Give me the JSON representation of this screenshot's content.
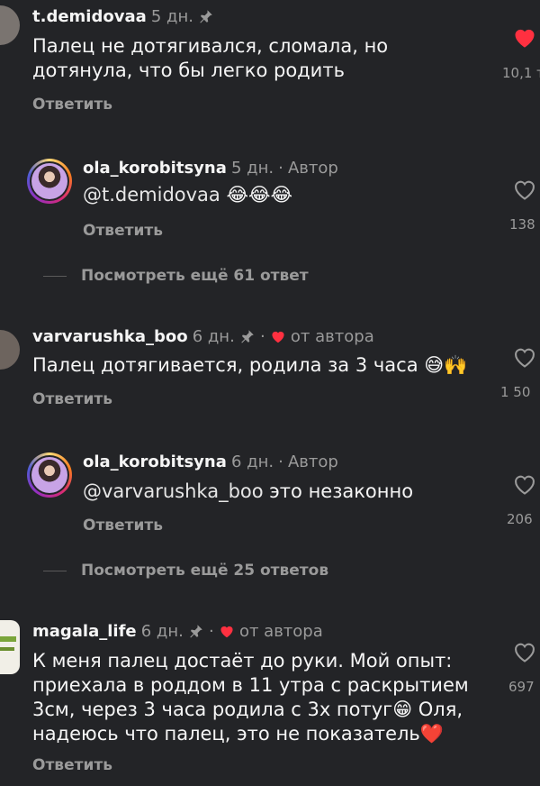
{
  "comments": [
    {
      "username": "t.demidovaa",
      "time": "5 дн.",
      "text": "Палец не дотягивался, сломала, но дотянула, что бы легко родить",
      "reply_label": "Ответить",
      "likes": "10,1 т.",
      "liked": true
    },
    {
      "username": "ola_korobitsyna",
      "time": "5 дн.",
      "author_label": "Автор",
      "mention": "@t.demidovaa",
      "text_suffix": "😂😂😂",
      "reply_label": "Ответить",
      "likes": "138"
    },
    {
      "username": "varvarushka_boo",
      "time": "6 дн.",
      "from_author_label": "от автора",
      "text": "Палец дотягивается, родила за 3 часа 😅🙌",
      "reply_label": "Ответить",
      "likes": "1 50"
    },
    {
      "username": "ola_korobitsyna",
      "time": "6 дн.",
      "author_label": "Автор",
      "mention": "@varvarushka_boo",
      "text_suffix": " это незаконно",
      "reply_label": "Ответить",
      "likes": "206"
    },
    {
      "username": "magala_life",
      "time": "6 дн.",
      "from_author_label": "от автора",
      "text": "К меня палец достаёт до руки. Мой опыт: приехала в роддом в 11 утра с раскрытием 3см, через 3 часа родила с 3х потуг😁 Оля, надеюсь что палец, это не показатель❤️",
      "reply_label": "Ответить",
      "likes": "697"
    }
  ],
  "more_replies": [
    {
      "label": "Посмотреть ещё 61 ответ"
    },
    {
      "label": "Посмотреть ещё 25 ответов"
    }
  ],
  "colors": {
    "background": "#232427",
    "heart_red": "#ff3040",
    "muted_text": "#9a9a9a"
  }
}
